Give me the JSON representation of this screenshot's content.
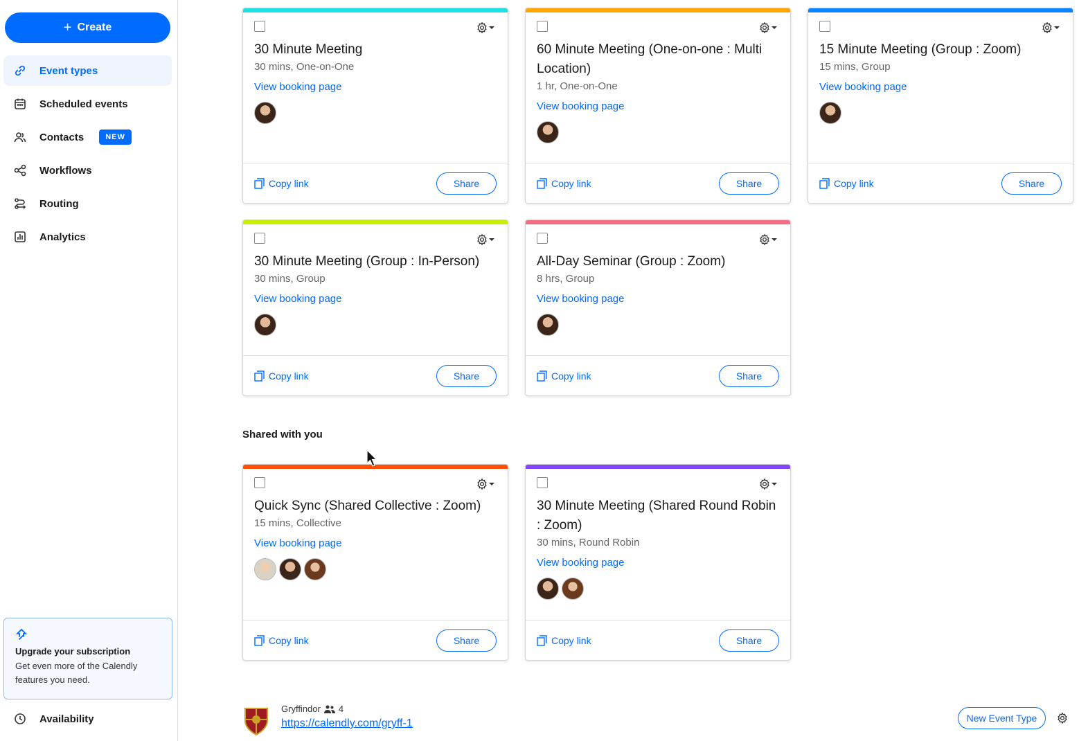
{
  "sidebar": {
    "create_label": "Create",
    "create_icon": "plus-icon",
    "items": [
      {
        "label": "Event types",
        "icon": "link-icon",
        "active": true
      },
      {
        "label": "Scheduled events",
        "icon": "calendar-icon"
      },
      {
        "label": "Contacts",
        "icon": "contacts-icon",
        "badge": "NEW"
      },
      {
        "label": "Workflows",
        "icon": "workflows-icon"
      },
      {
        "label": "Routing",
        "icon": "routing-icon"
      },
      {
        "label": "Analytics",
        "icon": "analytics-icon"
      }
    ],
    "upgrade": {
      "title": "Upgrade your subscription",
      "desc": "Get even more of the Calendly features you need."
    },
    "availability_label": "Availability"
  },
  "colors": {
    "accent": "#006bff",
    "cyan": "#1ee0e0",
    "orange": "#ffa600",
    "blue": "#0a84ff",
    "lime": "#c6f000",
    "pink": "#f36e84",
    "red_orange": "#ff4f00",
    "purple": "#8247f5"
  },
  "cards": [
    {
      "title": "30 Minute Meeting",
      "sub": "30 mins, One-on-One",
      "color": "#1ee0e0"
    },
    {
      "title": "60 Minute Meeting (One-on-one : Multi Location)",
      "sub": "1 hr, One-on-One",
      "color": "#ffa600"
    },
    {
      "title": "15 Minute Meeting (Group : Zoom)",
      "sub": "15 mins, Group",
      "color": "#0a84ff"
    },
    {
      "title": "30 Minute Meeting (Group : In-Person)",
      "sub": "30 mins, Group",
      "color": "#c6f000"
    },
    {
      "title": "All-Day Seminar (Group : Zoom)",
      "sub": "8 hrs, Group",
      "color": "#f36e84"
    }
  ],
  "shared_title": "Shared with you",
  "shared_cards": [
    {
      "title": "Quick Sync (Shared Collective : Zoom)",
      "sub": "15 mins, Collective",
      "color": "#ff4f00"
    },
    {
      "title": "30 Minute Meeting (Shared Round Robin : Zoom)",
      "sub": "30 mins, Round Robin",
      "color": "#8247f5"
    }
  ],
  "card_labels": {
    "view_booking": "View booking page",
    "copy_link": "Copy link",
    "share": "Share"
  },
  "team": {
    "name": "Gryffindor",
    "member_count": "4",
    "link": "https://calendly.com/gryff-1",
    "new_event_type": "New Event Type"
  }
}
